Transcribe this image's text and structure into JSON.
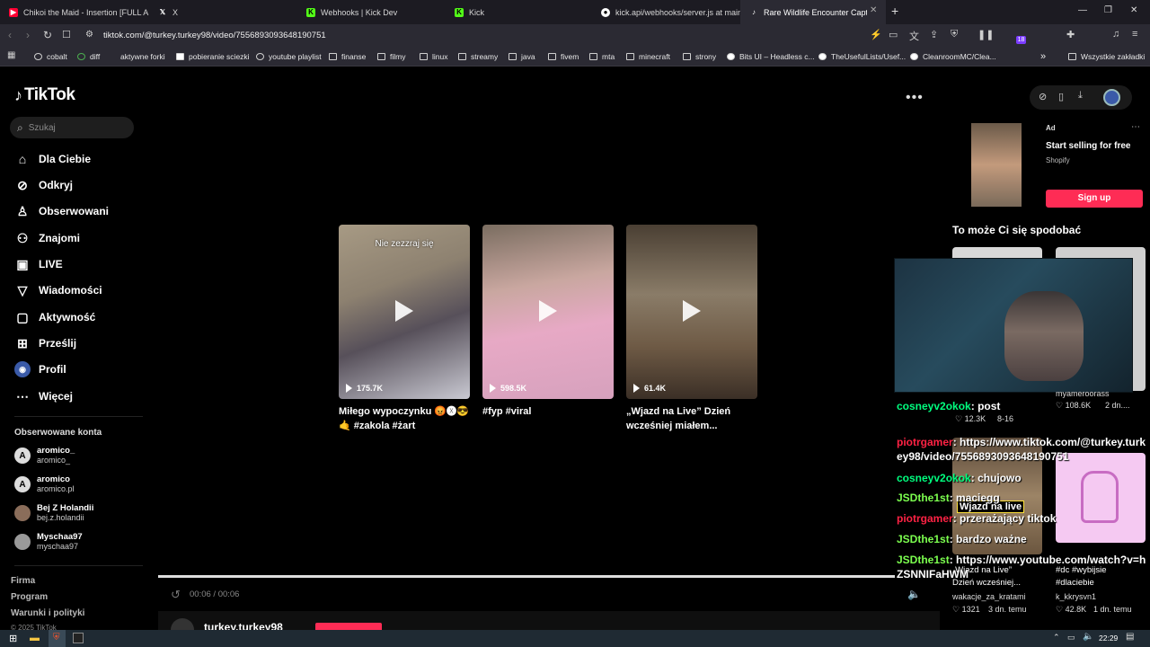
{
  "browser": {
    "tabs": [
      {
        "label": "Chikoi the Maid - Insertion [FULL AL",
        "favicon": "youtube",
        "color": "#ff0033"
      },
      {
        "label": "X",
        "favicon": "x",
        "color": "#ffffff"
      },
      {
        "label": "Webhooks | Kick Dev",
        "favicon": "kick",
        "color": "#53fc18"
      },
      {
        "label": "Kick",
        "favicon": "kick",
        "color": "#53fc18"
      },
      {
        "label": "kick.api/webhooks/server.js at main",
        "favicon": "github",
        "color": "#ffffff"
      },
      {
        "label": "Rare Wildlife Encounter Captured",
        "favicon": "tiktok",
        "color": "#ffffff"
      }
    ],
    "url": "tiktok.com/@turkey.turkey98/video/7556893093648190751",
    "bookmarks": [
      "cobalt",
      "diff",
      "aktywne forki",
      "pobieranie sciezki",
      "youtube playlist",
      "finanse",
      "filmy",
      "linux",
      "streamy",
      "java",
      "fivem",
      "mta",
      "minecraft",
      "strony",
      "Bits UI – Headless c...",
      "TheUsefulLists/Usef...",
      "CleanroomMC/Clea..."
    ],
    "all_bookmarks": "Wszystkie zakładki",
    "extension_badge": "18"
  },
  "tiktok": {
    "logo": "TikTok",
    "search_placeholder": "Szukaj",
    "nav": [
      "Dla Ciebie",
      "Odkryj",
      "Obserwowani",
      "Znajomi",
      "LIVE",
      "Wiadomości",
      "Aktywność",
      "Prześlij",
      "Profil",
      "Więcej"
    ],
    "followed_title": "Obserwowane konta",
    "followed": [
      {
        "name": "aromico_",
        "handle": "aromico_"
      },
      {
        "name": "aromico",
        "handle": "aromico.pl"
      },
      {
        "name": "Bej Z Holandii",
        "handle": "bej.z.holandii"
      },
      {
        "name": "Myschaa97",
        "handle": "myschaa97"
      }
    ],
    "footer": [
      "Firma",
      "Program",
      "Warunki i polityki",
      "© 2025 TikTok"
    ],
    "videos": [
      {
        "overlay": "Nie zezzraj się",
        "views": "175.7K",
        "caption": "Miłego wypoczynku 😡🅧😎 🤙 #zakola #żart"
      },
      {
        "overlay": "",
        "views": "598.5K",
        "caption": "#fyp #viral"
      },
      {
        "overlay": "",
        "views": "61.4K",
        "caption": "„Wjazd na Live” Dzień wcześniej miałem..."
      }
    ],
    "player": {
      "time": "00:06 / 00:06",
      "username": "turkey.turkey98"
    },
    "ad": {
      "label": "Ad",
      "title": "Start selling for free",
      "brand": "Shopify",
      "cta": "Sign up"
    },
    "recommend_title": "To może Ci się spodobać",
    "recommended": [
      {
        "title": "„Wjazd na Live”",
        "subtitle": "Dzień wcześniej...",
        "author": "wakacje_za_kratami",
        "likes": "1321",
        "time": "3 dn. temu",
        "overlay": "Wjazd na live"
      },
      {
        "title": "#dc #wybijsie",
        "subtitle": "#dlaciebie",
        "author": "k_kkrysvn1",
        "likes": "42.8K",
        "time": "1 dn. temu"
      }
    ],
    "partial_meta": [
      {
        "likes": "12.3K",
        "time": "8-16"
      },
      {
        "author": "myameroorass",
        "likes": "108.6K",
        "time": "2 dn...."
      }
    ]
  },
  "stream_chat": [
    {
      "user": "cosneyv2okok",
      "color": "#00ff7f",
      "msg": "post"
    },
    {
      "user": "piotrgamer",
      "color": "#ff2244",
      "msg": "https://www.tiktok.com/@turkey.turkey98/video/7556893093648190751"
    },
    {
      "user": "cosneyv2okok",
      "color": "#00ff7f",
      "msg": "chujowo"
    },
    {
      "user": "JSDthe1st",
      "color": "#7cff4f",
      "msg": "maciegg"
    },
    {
      "user": "piotrgamer",
      "color": "#ff2244",
      "msg": "przerażający tiktok"
    },
    {
      "user": "JSDthe1st",
      "color": "#7cff4f",
      "msg": "bardzo ważne"
    },
    {
      "user": "JSDthe1st",
      "color": "#7cff4f",
      "msg": "https://www.youtube.com/watch?v=hZSNNIFaHWM"
    }
  ],
  "taskbar": {
    "clock": "22:29"
  },
  "colors": {
    "accent": "#fe2c55",
    "sidebar_bg": "#000000",
    "chrome_bg": "#2b2a33"
  }
}
